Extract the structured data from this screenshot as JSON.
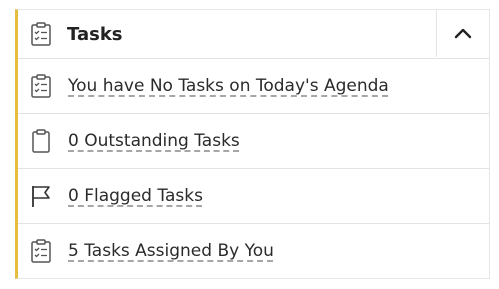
{
  "header": {
    "title": "Tasks",
    "icon": "clipboard-checklist-icon",
    "collapse_icon": "chevron-up-icon"
  },
  "rows": [
    {
      "label": "You have No Tasks on Today's Agenda",
      "icon": "clipboard-checklist-icon"
    },
    {
      "label": "0 Outstanding Tasks",
      "icon": "clipboard-icon"
    },
    {
      "label": "0 Flagged Tasks",
      "icon": "flag-icon"
    },
    {
      "label": "5 Tasks Assigned By You",
      "icon": "clipboard-checklist-icon"
    }
  ],
  "colors": {
    "accent": "#e7bd3f",
    "border": "#e3e3e3",
    "text": "#2b2b2b"
  }
}
